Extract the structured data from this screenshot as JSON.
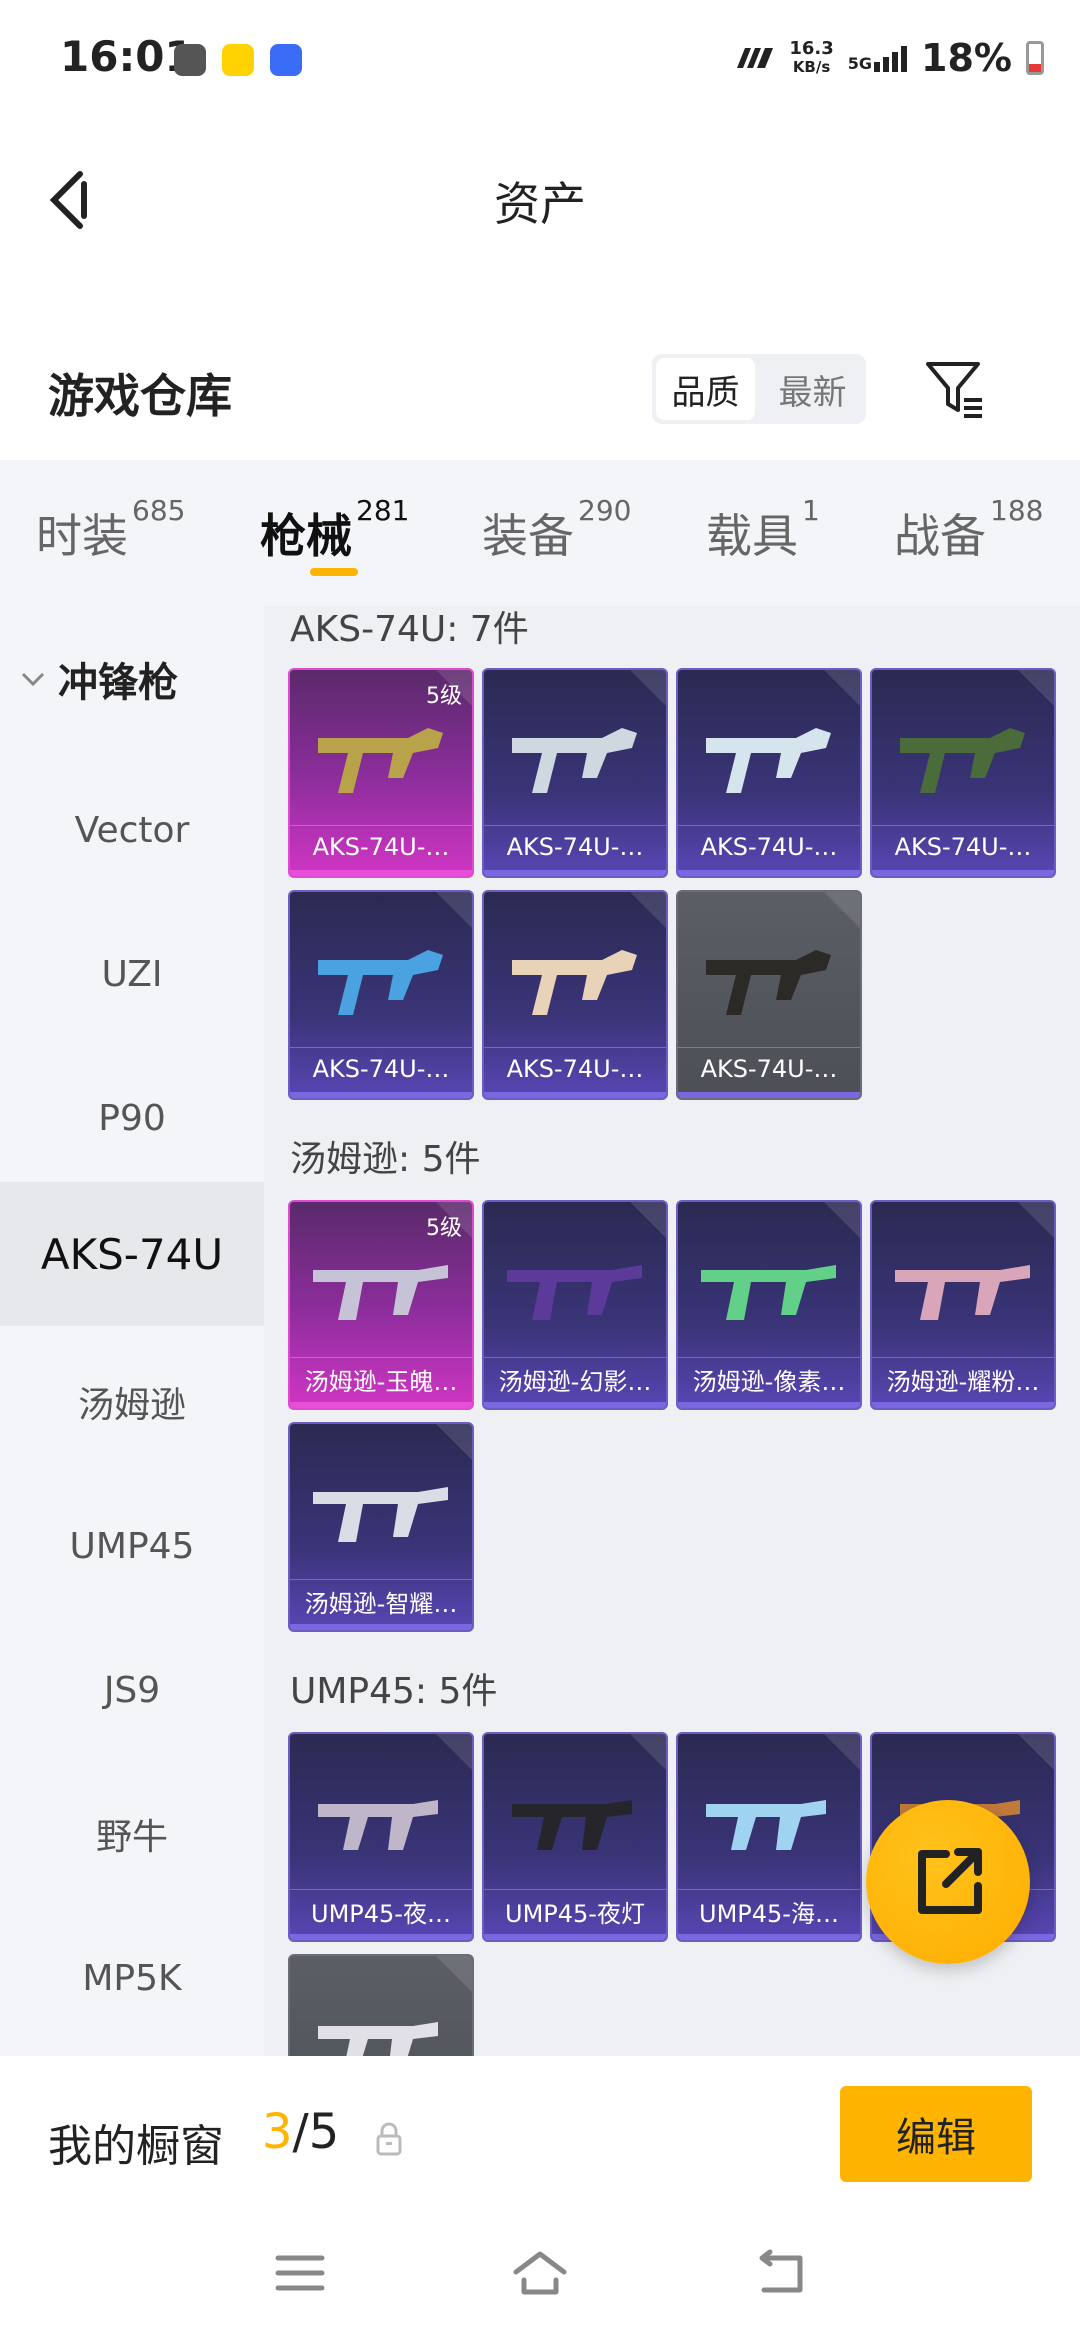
{
  "status_bar": {
    "time": "16:01",
    "net_speed_value": "16.3",
    "net_speed_unit": "KB/s",
    "network": "5G",
    "battery": "18%",
    "app_icons": [
      "game-icon",
      "notification-icon",
      "vivo-icon"
    ],
    "colors": {
      "battery_low": "#e53935"
    }
  },
  "header": {
    "title": "资产",
    "back_icon": "chevron-left-icon"
  },
  "warehouse": {
    "title": "游戏仓库",
    "sort_options": [
      "品质",
      "最新"
    ],
    "sort_selected": "品质",
    "filter_icon": "filter-icon"
  },
  "tabs": [
    {
      "label": "时装",
      "count": "685"
    },
    {
      "label": "枪械",
      "count": "281",
      "active": true
    },
    {
      "label": "装备",
      "count": "290"
    },
    {
      "label": "载具",
      "count": "1"
    },
    {
      "label": "战备",
      "count": "188"
    }
  ],
  "sidebar": {
    "group": "冲锋枪",
    "items": [
      "Vector",
      "UZI",
      "P90",
      "AKS-74U",
      "汤姆逊",
      "UMP45",
      "JS9",
      "野牛",
      "MP5K"
    ],
    "active": "AKS-74U"
  },
  "sections": [
    {
      "title": "AKS-74U: 7件",
      "cards": [
        {
          "label": "AKS-74U-…",
          "rarity": "gold",
          "level": "5级"
        },
        {
          "label": "AKS-74U-…",
          "rarity": "purple"
        },
        {
          "label": "AKS-74U-…",
          "rarity": "purple"
        },
        {
          "label": "AKS-74U-…",
          "rarity": "purple"
        },
        {
          "label": "AKS-74U-…",
          "rarity": "purple"
        },
        {
          "label": "AKS-74U-…",
          "rarity": "purple"
        },
        {
          "label": "AKS-74U-…",
          "rarity": "gray"
        }
      ]
    },
    {
      "title": "汤姆逊: 5件",
      "cards": [
        {
          "label": "汤姆逊-玉魄…",
          "rarity": "gold",
          "level": "5级"
        },
        {
          "label": "汤姆逊-幻影…",
          "rarity": "purple"
        },
        {
          "label": "汤姆逊-像素…",
          "rarity": "purple"
        },
        {
          "label": "汤姆逊-耀粉…",
          "rarity": "purple"
        },
        {
          "label": "汤姆逊-智耀…",
          "rarity": "purple"
        }
      ]
    },
    {
      "title": "UMP45: 5件",
      "cards": [
        {
          "label": "UMP45-夜…",
          "rarity": "purple"
        },
        {
          "label": "UMP45-夜灯",
          "rarity": "purple"
        },
        {
          "label": "UMP45-海…",
          "rarity": "purple"
        },
        {
          "label": "",
          "rarity": "purple"
        },
        {
          "label": "",
          "rarity": "gray"
        }
      ]
    }
  ],
  "fab": {
    "icon": "share-icon",
    "color": "#ffb400"
  },
  "showcase": {
    "label": "我的橱窗",
    "current": "3",
    "separator": "/",
    "total": "5",
    "lock_icon": "lock-icon",
    "edit_label": "编辑",
    "accent": "#ffb400"
  },
  "navbar": {
    "icons": [
      "menu-icon",
      "home-icon",
      "back-icon"
    ]
  }
}
